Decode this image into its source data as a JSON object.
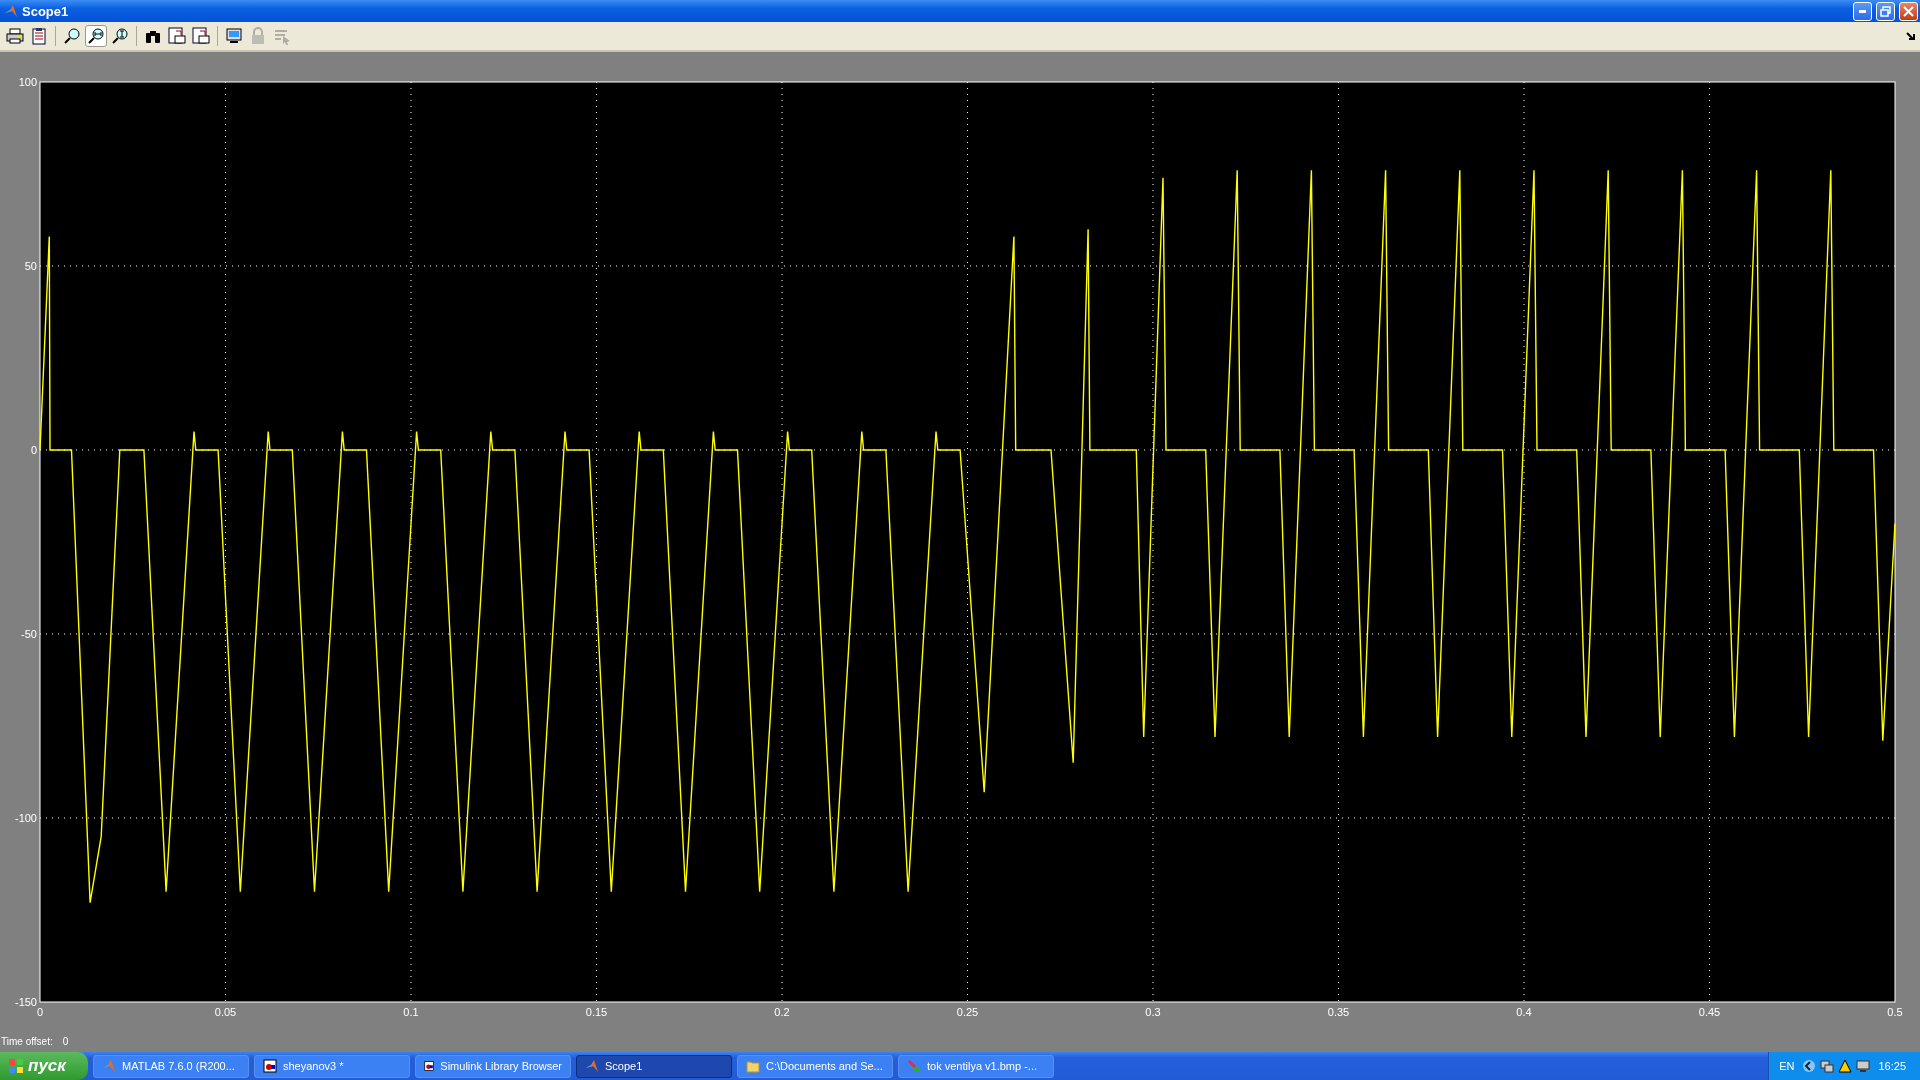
{
  "window": {
    "title": "Scope1"
  },
  "toolbar": [
    {
      "kind": "print",
      "selected": false,
      "disabled": false
    },
    {
      "kind": "parameters",
      "selected": false,
      "disabled": false
    },
    {
      "kind": "sep"
    },
    {
      "kind": "zoom",
      "selected": false,
      "disabled": false
    },
    {
      "kind": "zoom-x",
      "selected": true,
      "disabled": false
    },
    {
      "kind": "zoom-y",
      "selected": false,
      "disabled": false
    },
    {
      "kind": "sep"
    },
    {
      "kind": "autoscale",
      "selected": false,
      "disabled": false
    },
    {
      "kind": "save-axes",
      "selected": false,
      "disabled": false
    },
    {
      "kind": "restore-axes",
      "selected": false,
      "disabled": false
    },
    {
      "kind": "sep"
    },
    {
      "kind": "floating",
      "selected": false,
      "disabled": false
    },
    {
      "kind": "lock",
      "selected": false,
      "disabled": true
    },
    {
      "kind": "signal-select",
      "selected": false,
      "disabled": true
    }
  ],
  "chart_data": {
    "type": "line",
    "grid": true,
    "xlim": [
      0,
      0.5
    ],
    "ylim": [
      -150,
      100
    ],
    "xticks": [
      0,
      0.05,
      0.1,
      0.15,
      0.2,
      0.25,
      0.3,
      0.35,
      0.4,
      0.45,
      0.5
    ],
    "yticks": [
      -150,
      -100,
      -50,
      0,
      50,
      100
    ],
    "x": [
      0,
      0.0025,
      0.0027,
      0.0085,
      0.0135,
      0.0165,
      0.0215,
      0.028,
      0.034,
      0.0415,
      0.042,
      0.048,
      0.054,
      0.0615,
      0.062,
      0.068,
      0.074,
      0.0815,
      0.082,
      0.088,
      0.094,
      0.1015,
      0.102,
      0.108,
      0.114,
      0.1215,
      0.122,
      0.128,
      0.134,
      0.1415,
      0.142,
      0.148,
      0.154,
      0.1615,
      0.162,
      0.168,
      0.174,
      0.1815,
      0.182,
      0.188,
      0.194,
      0.2015,
      0.202,
      0.208,
      0.214,
      0.2215,
      0.222,
      0.228,
      0.234,
      0.2415,
      0.242,
      0.248,
      0.2545,
      0.2625,
      0.263,
      0.2725,
      0.2785,
      0.2825,
      0.283,
      0.2955,
      0.2975,
      0.3027,
      0.3035,
      0.3142,
      0.3167,
      0.3227,
      0.3235,
      0.3342,
      0.3367,
      0.3427,
      0.3435,
      0.3542,
      0.3567,
      0.3627,
      0.3635,
      0.3742,
      0.3767,
      0.3827,
      0.3835,
      0.3942,
      0.3967,
      0.4027,
      0.4035,
      0.4142,
      0.4167,
      0.4227,
      0.4235,
      0.4342,
      0.4367,
      0.4427,
      0.4435,
      0.4542,
      0.4567,
      0.4627,
      0.4635,
      0.4742,
      0.4767,
      0.4827,
      0.4835,
      0.4942,
      0.4967,
      0.5
    ],
    "series": [
      {
        "color": "#ffff00",
        "values": [
          0,
          58,
          0,
          0,
          -123,
          -105,
          0,
          0,
          -120,
          5,
          0,
          0,
          -120,
          5,
          0,
          0,
          -120,
          5,
          0,
          0,
          -120,
          5,
          0,
          0,
          -120,
          5,
          0,
          0,
          -120,
          5,
          0,
          0,
          -120,
          5,
          0,
          0,
          -120,
          5,
          0,
          0,
          -120,
          5,
          0,
          0,
          -120,
          5,
          0,
          0,
          -120,
          5,
          0,
          0,
          -93,
          58,
          0,
          0,
          -85,
          60,
          0,
          0,
          -78,
          74,
          0,
          0,
          -78,
          76,
          0,
          0,
          -78,
          76,
          0,
          0,
          -78,
          76,
          0,
          0,
          -78,
          76,
          0,
          0,
          -78,
          76,
          0,
          0,
          -78,
          76,
          0,
          0,
          -78,
          76,
          0,
          0,
          -78,
          76,
          0,
          0,
          -78,
          76,
          0,
          0,
          -79,
          -20
        ]
      }
    ]
  },
  "time_offset": {
    "label": "Time offset:",
    "value": "0"
  },
  "taskbar": {
    "start": "пуск",
    "tasks": [
      {
        "label": "MATLAB  7.6.0 (R200...",
        "kind": "matlab",
        "selected": false
      },
      {
        "label": "sheyanov3 *",
        "kind": "model",
        "selected": false
      },
      {
        "label": "Simulink Library Browser",
        "kind": "model",
        "selected": false
      },
      {
        "label": "Scope1",
        "kind": "matlab",
        "selected": true
      },
      {
        "label": "C:\\Documents and Se...",
        "kind": "folder",
        "selected": false
      },
      {
        "label": "tok ventilya v1.bmp -...",
        "kind": "paint",
        "selected": false
      }
    ],
    "language": "EN",
    "clock": "16:25"
  }
}
